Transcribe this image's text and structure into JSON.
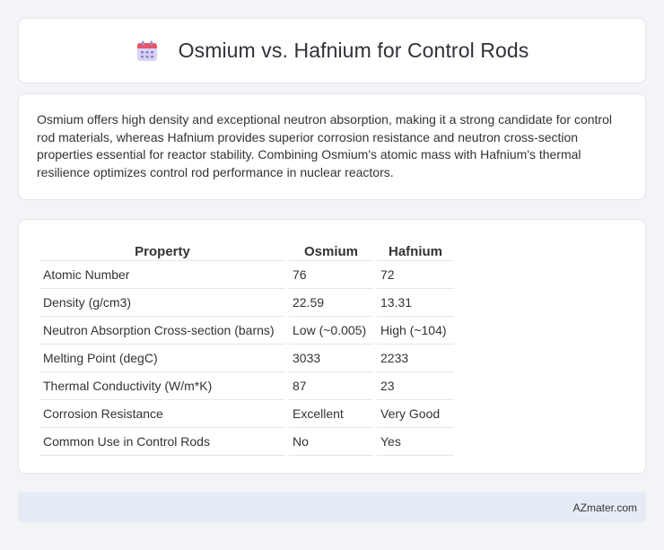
{
  "header": {
    "title": "Osmium vs. Hafnium for Control Rods",
    "icon": "calendar-icon"
  },
  "intro": {
    "text": "Osmium offers high density and exceptional neutron absorption, making it a strong candidate for control rod materials, whereas Hafnium provides superior corrosion resistance and neutron cross-section properties essential for reactor stability. Combining Osmium's atomic mass with Hafnium's thermal resilience optimizes control rod performance in nuclear reactors."
  },
  "table": {
    "headers": [
      "Property",
      "Osmium",
      "Hafnium"
    ],
    "rows": [
      [
        "Atomic Number",
        "76",
        "72"
      ],
      [
        "Density (g/cm3)",
        "22.59",
        "13.31"
      ],
      [
        "Neutron Absorption Cross-section (barns)",
        "Low (~0.005)",
        "High (~104)"
      ],
      [
        "Melting Point (degC)",
        "3033",
        "2233"
      ],
      [
        "Thermal Conductivity (W/m*K)",
        "87",
        "23"
      ],
      [
        "Corrosion Resistance",
        "Excellent",
        "Very Good"
      ],
      [
        "Common Use in Control Rods",
        "No",
        "Yes"
      ]
    ]
  },
  "footer": {
    "text": "AZmater.com"
  },
  "colors": {
    "background": "#f3f4f7",
    "card": "#ffffff",
    "footer": "#e6ecf5",
    "icon_top": "#e8556b",
    "icon_body": "#c9c3ef"
  }
}
